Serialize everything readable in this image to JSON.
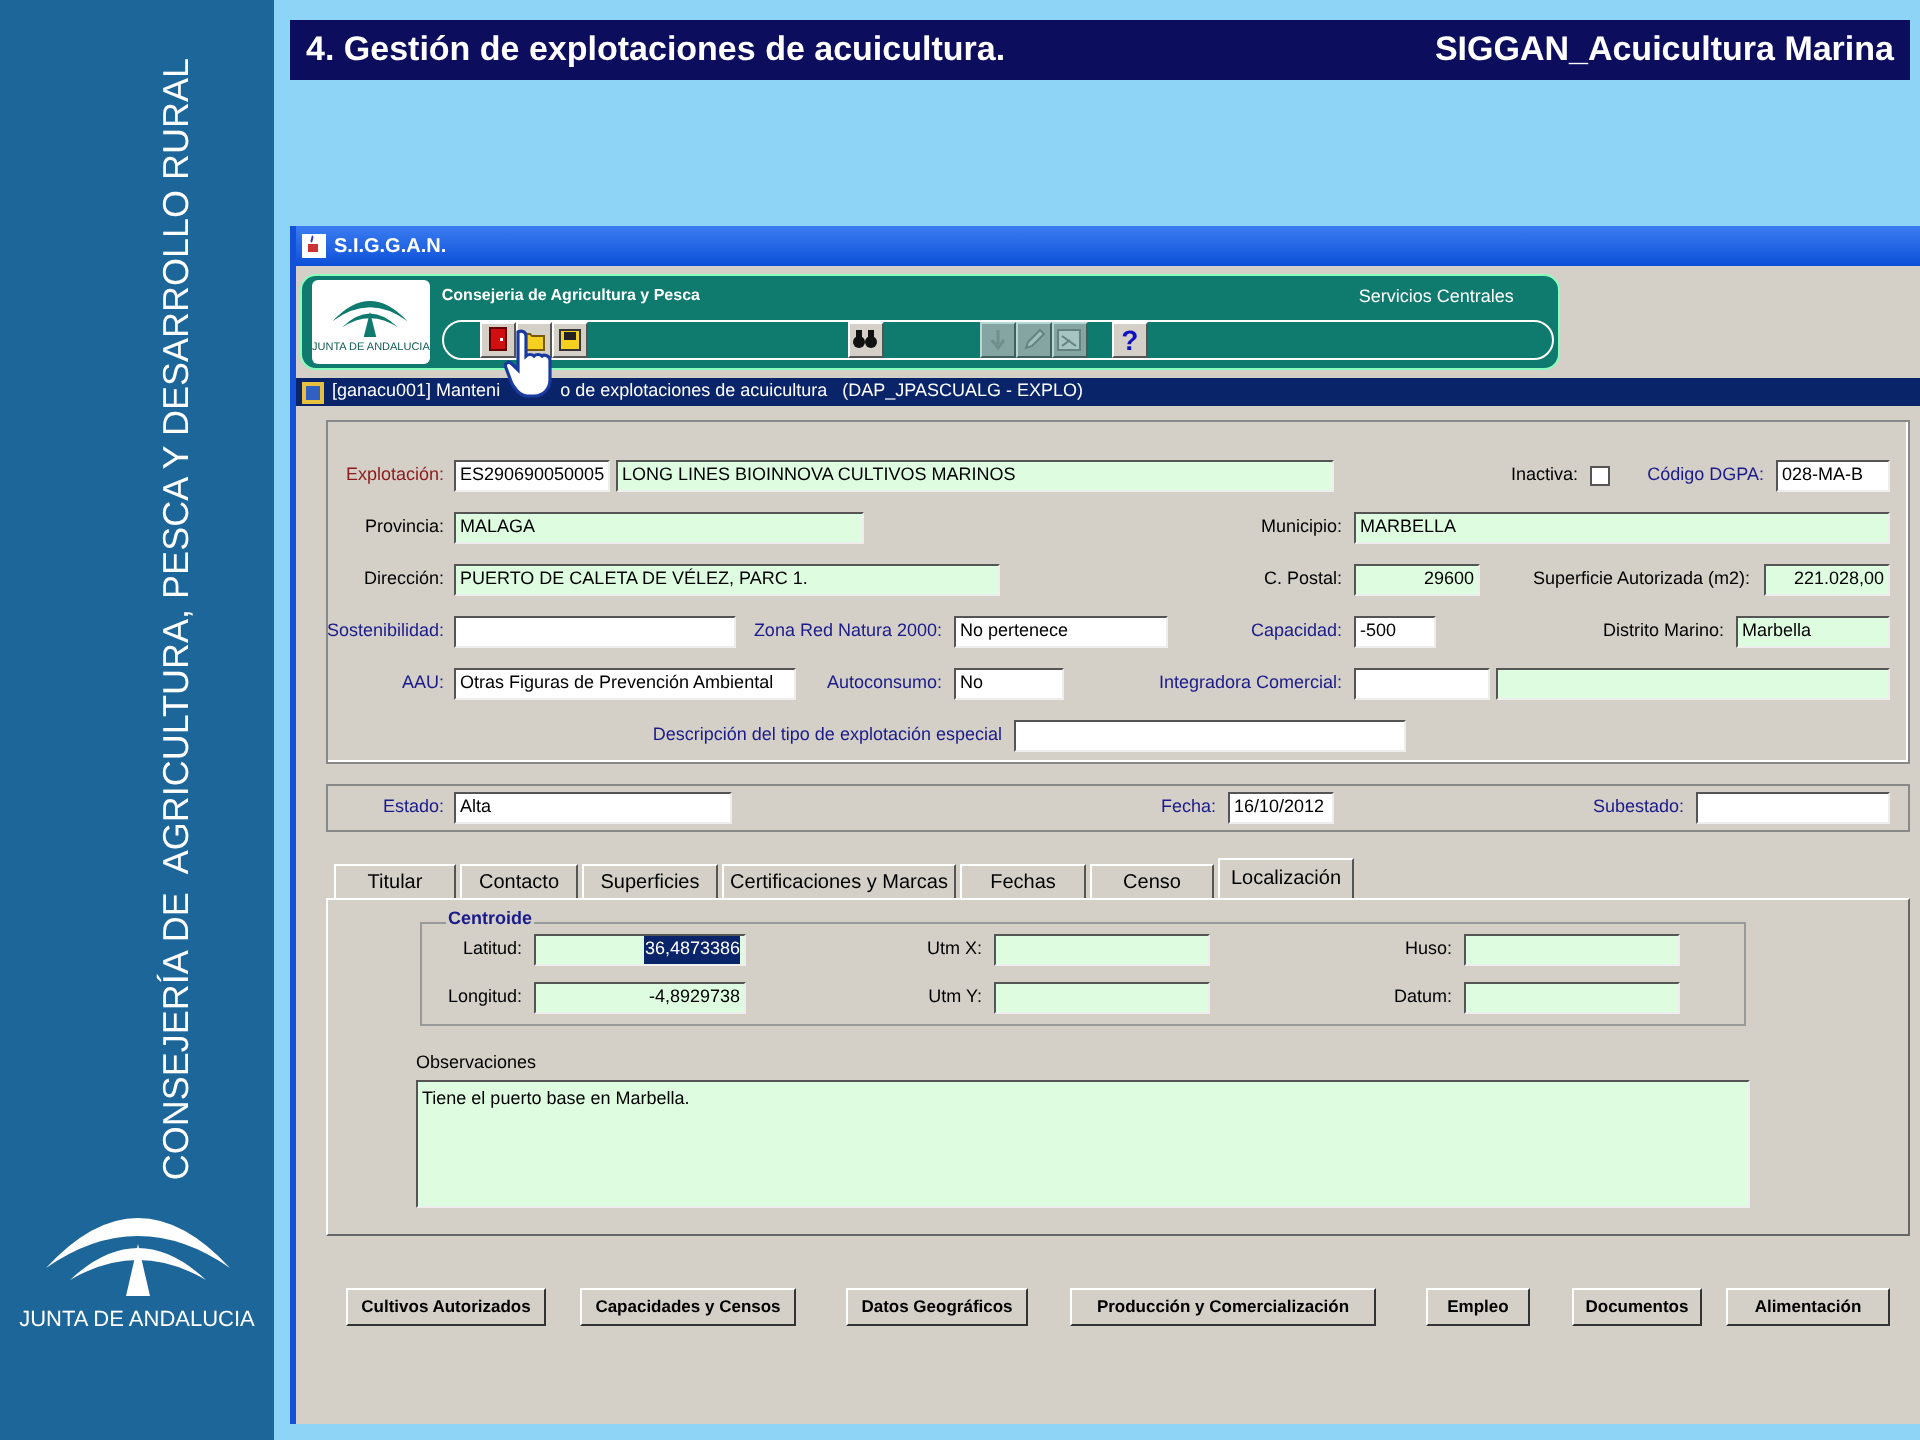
{
  "slide": {
    "title": "4. Gestión de explotaciones de acuicultura.",
    "subtitle": "SIGGAN_Acuicultura Marina",
    "side_text": "CONSEJERÍA DE  AGRICULTURA, PESCA Y DESARROLLO RURAL",
    "logo_text": "JUNTA DE ANDALUCIA"
  },
  "window": {
    "title": "S.I.G.G.A.N.",
    "header": {
      "logo_text": "JUNTA DE ANDALUCIA",
      "org": "Consejeria de Agricultura y Pesca",
      "office": "Servicios Centrales",
      "toolbar": [
        [
          {
            "disabled": false
          },
          {
            "disabled": false
          },
          {
            "disabled": false
          }
        ],
        [
          {
            "disabled": false
          }
        ],
        [
          {
            "disabled": true
          },
          {
            "disabled": true
          },
          {
            "disabled": true
          }
        ],
        [
          {
            "disabled": false,
            "label": "?"
          }
        ]
      ]
    },
    "form_title_parts": [
      "[ganacu001] Manteni",
      "o de explotaciones de acuicultura   (DAP_JPASCUALG - EXPLO)"
    ]
  },
  "form": {
    "rows": [
      {
        "items": [
          {
            "label": "Explotación:",
            "color": "#8b1a1a",
            "fields": [
              {
                "kind": "text",
                "value": "ES290690050005",
                "editable": true
              },
              {
                "kind": "text",
                "value": "LONG LINES BIOINNOVA CULTIVOS MARINOS",
                "editable": false
              }
            ]
          },
          {
            "label": "Inactiva:",
            "color": "#000000",
            "fields": [
              {
                "kind": "checkbox",
                "checked": false
              }
            ]
          },
          {
            "label": "Código DGPA:",
            "color": "#1a1a8a",
            "fields": [
              {
                "kind": "text",
                "value": "028-MA-B",
                "editable": true
              }
            ]
          }
        ]
      },
      {
        "items": [
          {
            "label": "Provincia:",
            "color": "#000000",
            "fields": [
              {
                "kind": "text",
                "value": "MALAGA",
                "editable": false
              }
            ]
          },
          {
            "label": "Municipio:",
            "color": "#000000",
            "fields": [
              {
                "kind": "text",
                "value": "MARBELLA",
                "editable": false
              }
            ]
          }
        ]
      },
      {
        "items": [
          {
            "label": "Dirección:",
            "color": "#000000",
            "fields": [
              {
                "kind": "text",
                "value": "PUERTO DE CALETA DE VÉLEZ, PARC 1.",
                "editable": false
              }
            ]
          },
          {
            "label": "C. Postal:",
            "color": "#000000",
            "fields": [
              {
                "kind": "text",
                "value": "29600",
                "editable": false,
                "right_aligned": true
              }
            ]
          },
          {
            "label": "Superficie Autorizada (m2):",
            "color": "#000000",
            "fields": [
              {
                "kind": "text",
                "value": "221.028,00",
                "editable": false,
                "right_aligned": true
              }
            ]
          }
        ]
      },
      {
        "items": [
          {
            "label": "Sostenibilidad:",
            "color": "#1a1a8a",
            "fields": [
              {
                "kind": "text",
                "editable": true
              }
            ]
          },
          {
            "label": "Zona Red Natura 2000:",
            "color": "#1a1a8a",
            "fields": [
              {
                "kind": "text",
                "value": "No pertenece",
                "editable": true
              }
            ]
          },
          {
            "label": "Capacidad:",
            "color": "#1a1a8a",
            "fields": [
              {
                "kind": "text",
                "value": "-500",
                "editable": true
              }
            ]
          },
          {
            "label": "Distrito Marino:",
            "color": "#000000",
            "fields": [
              {
                "kind": "text",
                "value": "Marbella",
                "editable": false
              }
            ]
          }
        ]
      },
      {
        "items": [
          {
            "label": "AAU:",
            "color": "#1a1a8a",
            "fields": [
              {
                "kind": "text",
                "value": "Otras Figuras de Prevención Ambiental",
                "editable": true
              }
            ]
          },
          {
            "label": "Autoconsumo:",
            "color": "#1a1a8a",
            "fields": [
              {
                "kind": "text",
                "value": "No",
                "editable": true
              }
            ]
          },
          {
            "label": "Integradora Comercial:",
            "color": "#1a1a8a",
            "fields": [
              {
                "kind": "text",
                "editable": true
              },
              {
                "kind": "text",
                "editable": false
              }
            ]
          }
        ]
      },
      {
        "items": [
          {
            "label": "Descripción del tipo de explotación especial",
            "color": "#1a1a8a",
            "fields": [
              {
                "kind": "text",
                "editable": true
              }
            ]
          }
        ]
      }
    ]
  },
  "status_panel": {
    "items": [
      {
        "label": "Estado:",
        "color": "#1a1a8a",
        "fields": [
          {
            "kind": "text",
            "value": "Alta",
            "editable": true
          }
        ]
      },
      {
        "label": "Fecha:",
        "color": "#1a1a8a",
        "fields": [
          {
            "kind": "text",
            "value": "16/10/2012",
            "editable": true
          }
        ]
      },
      {
        "label": "Subestado:",
        "color": "#1a1a8a",
        "fields": [
          {
            "kind": "text",
            "editable": true
          }
        ]
      }
    ]
  },
  "tabs": [
    {
      "label": "Titular",
      "selected": false
    },
    {
      "label": "Contacto",
      "selected": false
    },
    {
      "label": "Superficies",
      "selected": false
    },
    {
      "label": "Certificaciones y Marcas",
      "selected": false
    },
    {
      "label": "Fechas",
      "selected": false
    },
    {
      "label": "Censo",
      "selected": false
    },
    {
      "label": "Localización",
      "selected": true
    }
  ],
  "localizacion": {
    "group_title": "Centroide",
    "rows": [
      {
        "items": [
          {
            "label": "Latitud:",
            "color": "#000000",
            "fields": [
              {
                "kind": "text",
                "value": "36,4873386",
                "editable": false,
                "right_aligned": true,
                "text_selected": true
              }
            ]
          },
          {
            "label": "Utm X:",
            "color": "#000000",
            "fields": [
              {
                "kind": "text",
                "editable": false
              }
            ]
          },
          {
            "label": "Huso:",
            "color": "#000000",
            "fields": [
              {
                "kind": "text",
                "editable": false
              }
            ]
          }
        ]
      },
      {
        "items": [
          {
            "label": "Longitud:",
            "color": "#000000",
            "fields": [
              {
                "kind": "text",
                "value": "-4,8929738",
                "editable": false,
                "right_aligned": true,
                "text_selected": false
              }
            ]
          },
          {
            "label": "Utm Y:",
            "color": "#000000",
            "fields": [
              {
                "kind": "text",
                "editable": false
              }
            ]
          },
          {
            "label": "Datum:",
            "color": "#000000",
            "fields": [
              {
                "kind": "text",
                "editable": false
              }
            ]
          }
        ]
      }
    ],
    "notes_label": "Observaciones",
    "notes": "Tiene el puerto base en Marbella."
  },
  "buttons": [
    "Cultivos Autorizados",
    "Capacidades y Censos",
    "Datos Geográficos",
    "Producción y Comercialización",
    "Empleo",
    "Documentos",
    "Alimentación"
  ]
}
